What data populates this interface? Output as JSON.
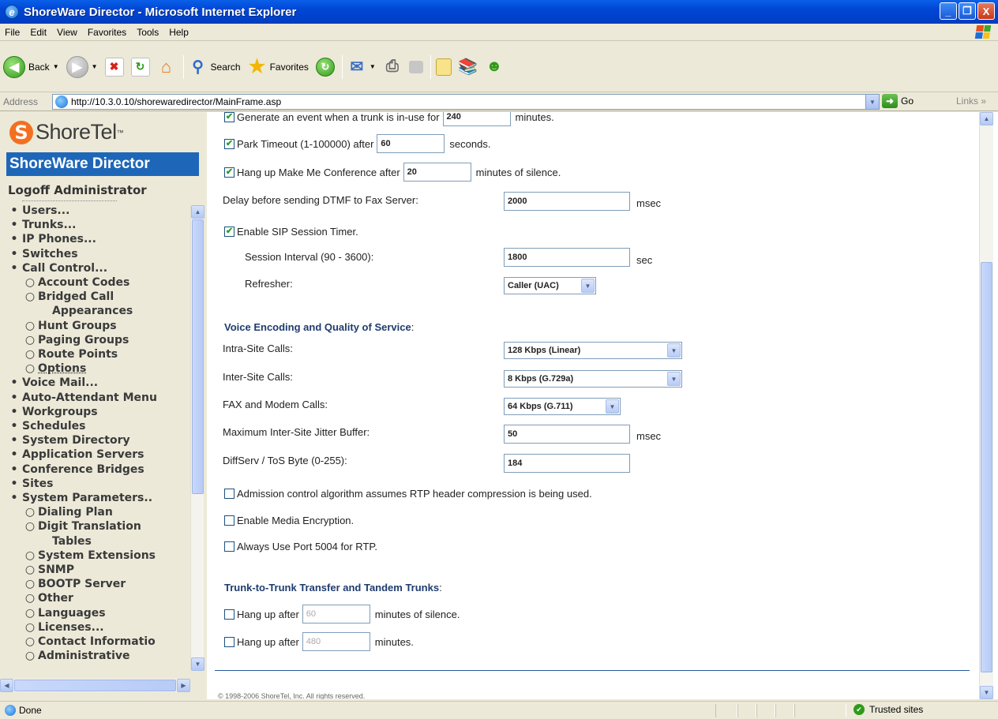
{
  "window": {
    "title": "ShoreWare Director - Microsoft Internet Explorer",
    "minimize": "_",
    "maximize": "❐",
    "close": "X"
  },
  "menu": [
    "File",
    "Edit",
    "View",
    "Favorites",
    "Tools",
    "Help"
  ],
  "toolbar": {
    "back_label": "Back",
    "search_label": "Search",
    "favorites_label": "Favorites"
  },
  "address": {
    "label": "Address",
    "url": "http://10.3.0.10/shorewaredirector/MainFrame.asp",
    "go_label": "Go",
    "links_label": "Links"
  },
  "sidebar": {
    "logo_text": "ShoreTel",
    "logo_tm": "™",
    "banner": "ShoreWare Director",
    "logoff": "Logoff Administrator",
    "items": [
      {
        "level": 0,
        "bullet": "•",
        "label": "Users..."
      },
      {
        "level": 0,
        "bullet": "•",
        "label": "Trunks..."
      },
      {
        "level": 0,
        "bullet": "•",
        "label": "IP Phones..."
      },
      {
        "level": 0,
        "bullet": "•",
        "label": "Switches"
      },
      {
        "level": 0,
        "bullet": "•",
        "label": "Call Control..."
      },
      {
        "level": 1,
        "bullet": "○",
        "label": "Account Codes"
      },
      {
        "level": 1,
        "bullet": "○",
        "label": "Bridged Call"
      },
      {
        "level": 2,
        "bullet": "",
        "label": "Appearances"
      },
      {
        "level": 1,
        "bullet": "○",
        "label": "Hunt Groups"
      },
      {
        "level": 1,
        "bullet": "○",
        "label": "Paging Groups"
      },
      {
        "level": 1,
        "bullet": "○",
        "label": "Route Points"
      },
      {
        "level": 1,
        "bullet": "○",
        "label": "Options",
        "selected": true
      },
      {
        "level": 0,
        "bullet": "•",
        "label": "Voice Mail..."
      },
      {
        "level": 0,
        "bullet": "•",
        "label": "Auto-Attendant Menu"
      },
      {
        "level": 0,
        "bullet": "•",
        "label": "Workgroups"
      },
      {
        "level": 0,
        "bullet": "•",
        "label": "Schedules"
      },
      {
        "level": 0,
        "bullet": "•",
        "label": "System Directory"
      },
      {
        "level": 0,
        "bullet": "•",
        "label": "Application Servers"
      },
      {
        "level": 0,
        "bullet": "•",
        "label": "Conference Bridges"
      },
      {
        "level": 0,
        "bullet": "•",
        "label": "Sites"
      },
      {
        "level": 0,
        "bullet": "•",
        "label": "System Parameters.."
      },
      {
        "level": 1,
        "bullet": "○",
        "label": "Dialing Plan"
      },
      {
        "level": 1,
        "bullet": "○",
        "label": "Digit Translation"
      },
      {
        "level": 2,
        "bullet": "",
        "label": "Tables"
      },
      {
        "level": 1,
        "bullet": "○",
        "label": "System Extensions"
      },
      {
        "level": 1,
        "bullet": "○",
        "label": "SNMP"
      },
      {
        "level": 1,
        "bullet": "○",
        "label": "BOOTP Server"
      },
      {
        "level": 1,
        "bullet": "○",
        "label": "Other"
      },
      {
        "level": 1,
        "bullet": "○",
        "label": "Languages"
      },
      {
        "level": 1,
        "bullet": "○",
        "label": "Licenses..."
      },
      {
        "level": 1,
        "bullet": "○",
        "label": "Contact Informatio"
      },
      {
        "level": 1,
        "bullet": "○",
        "label": "Administrative"
      }
    ]
  },
  "form": {
    "trunk_event_label": "Generate an event when a trunk is in-use for",
    "trunk_event_value": "240",
    "trunk_event_units": "minutes.",
    "park_timeout_label": "Park Timeout (1-100000) after",
    "park_timeout_value": "60",
    "park_timeout_units": "seconds.",
    "hangup_conf_label": "Hang up Make Me Conference after",
    "hangup_conf_value": "20",
    "hangup_conf_units": "minutes of silence.",
    "dtmf_label": "Delay before sending DTMF to Fax Server:",
    "dtmf_value": "2000",
    "dtmf_units": "msec",
    "sip_timer_label": "Enable SIP Session Timer.",
    "session_interval_label": "Session Interval (90 - 3600):",
    "session_interval_value": "1800",
    "session_interval_units": "sec",
    "refresher_label": "Refresher:",
    "refresher_value": "Caller (UAC)",
    "voice_section": "Voice Encoding and Quality of Service",
    "intra_site_label": "Intra-Site Calls:",
    "intra_site_value": "128 Kbps (Linear)",
    "inter_site_label": "Inter-Site Calls:",
    "inter_site_value": "8 Kbps (G.729a)",
    "fax_label": "FAX and Modem Calls:",
    "fax_value": "64 Kbps (G.711)",
    "jitter_label": "Maximum Inter-Site Jitter Buffer:",
    "jitter_value": "50",
    "jitter_units": "msec",
    "diffserv_label": "DiffServ / ToS Byte (0-255):",
    "diffserv_value": "184",
    "admission_label": "Admission control algorithm assumes RTP header compression is being used.",
    "media_enc_label": "Enable Media Encryption.",
    "port5004_label": "Always Use Port 5004 for RTP.",
    "trunk_section": "Trunk-to-Trunk Transfer and Tandem Trunks",
    "hangup_silence_label": "Hang up after",
    "hangup_silence_value": "60",
    "hangup_silence_units": "minutes of silence.",
    "hangup_minutes_label": "Hang up after",
    "hangup_minutes_value": "480",
    "hangup_minutes_units": "minutes.",
    "copyright": "© 1998-2006 ShoreTel, Inc. All rights reserved."
  },
  "status": {
    "left": "Done",
    "zone": "Trusted sites"
  }
}
